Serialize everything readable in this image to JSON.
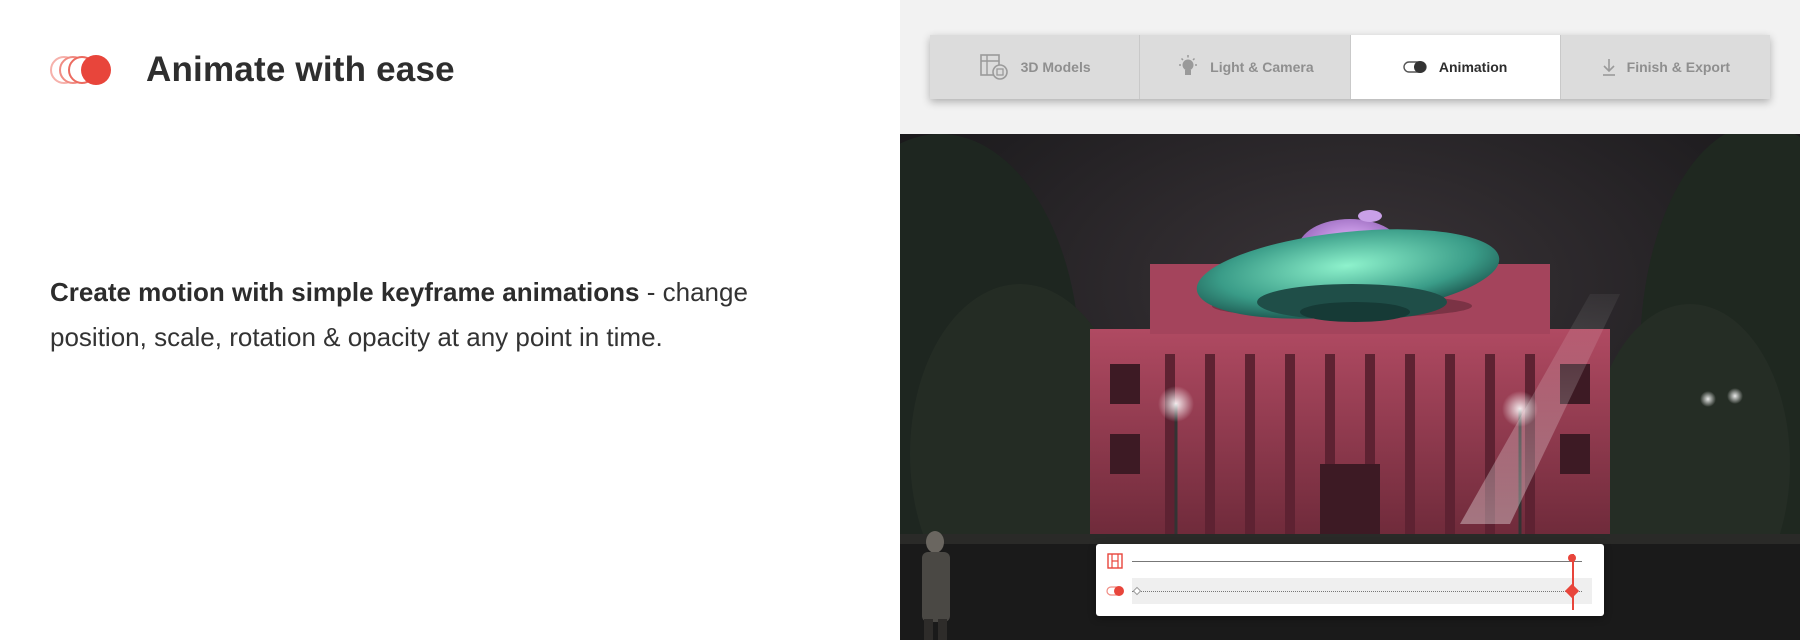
{
  "feature": {
    "icon": "animation-circles-icon",
    "title": "Animate with ease"
  },
  "description": {
    "bold": "Create motion with simple keyframe animations",
    "rest": " - change position, scale, rotation & opacity at any point in time."
  },
  "tabs": [
    {
      "label": "3D Models",
      "icon": "3d-models-icon",
      "active": false
    },
    {
      "label": "Light & Camera",
      "icon": "lightbulb-icon",
      "active": false
    },
    {
      "label": "Animation",
      "icon": "animation-toggle-icon",
      "active": true
    },
    {
      "label": "Finish & Export",
      "icon": "download-arrow-icon",
      "active": false
    }
  ],
  "scene": {
    "description_icon": "ufo-over-building-photo"
  },
  "timeline": {
    "rows": [
      {
        "icon": "film-strip-icon"
      },
      {
        "icon": "animation-toggle-icon"
      }
    ]
  },
  "colors": {
    "accent": "#e8453b",
    "tab_bg": "#dcdcdc",
    "active_tab_bg": "#ffffff",
    "panel_bg": "#f2f2f2"
  }
}
